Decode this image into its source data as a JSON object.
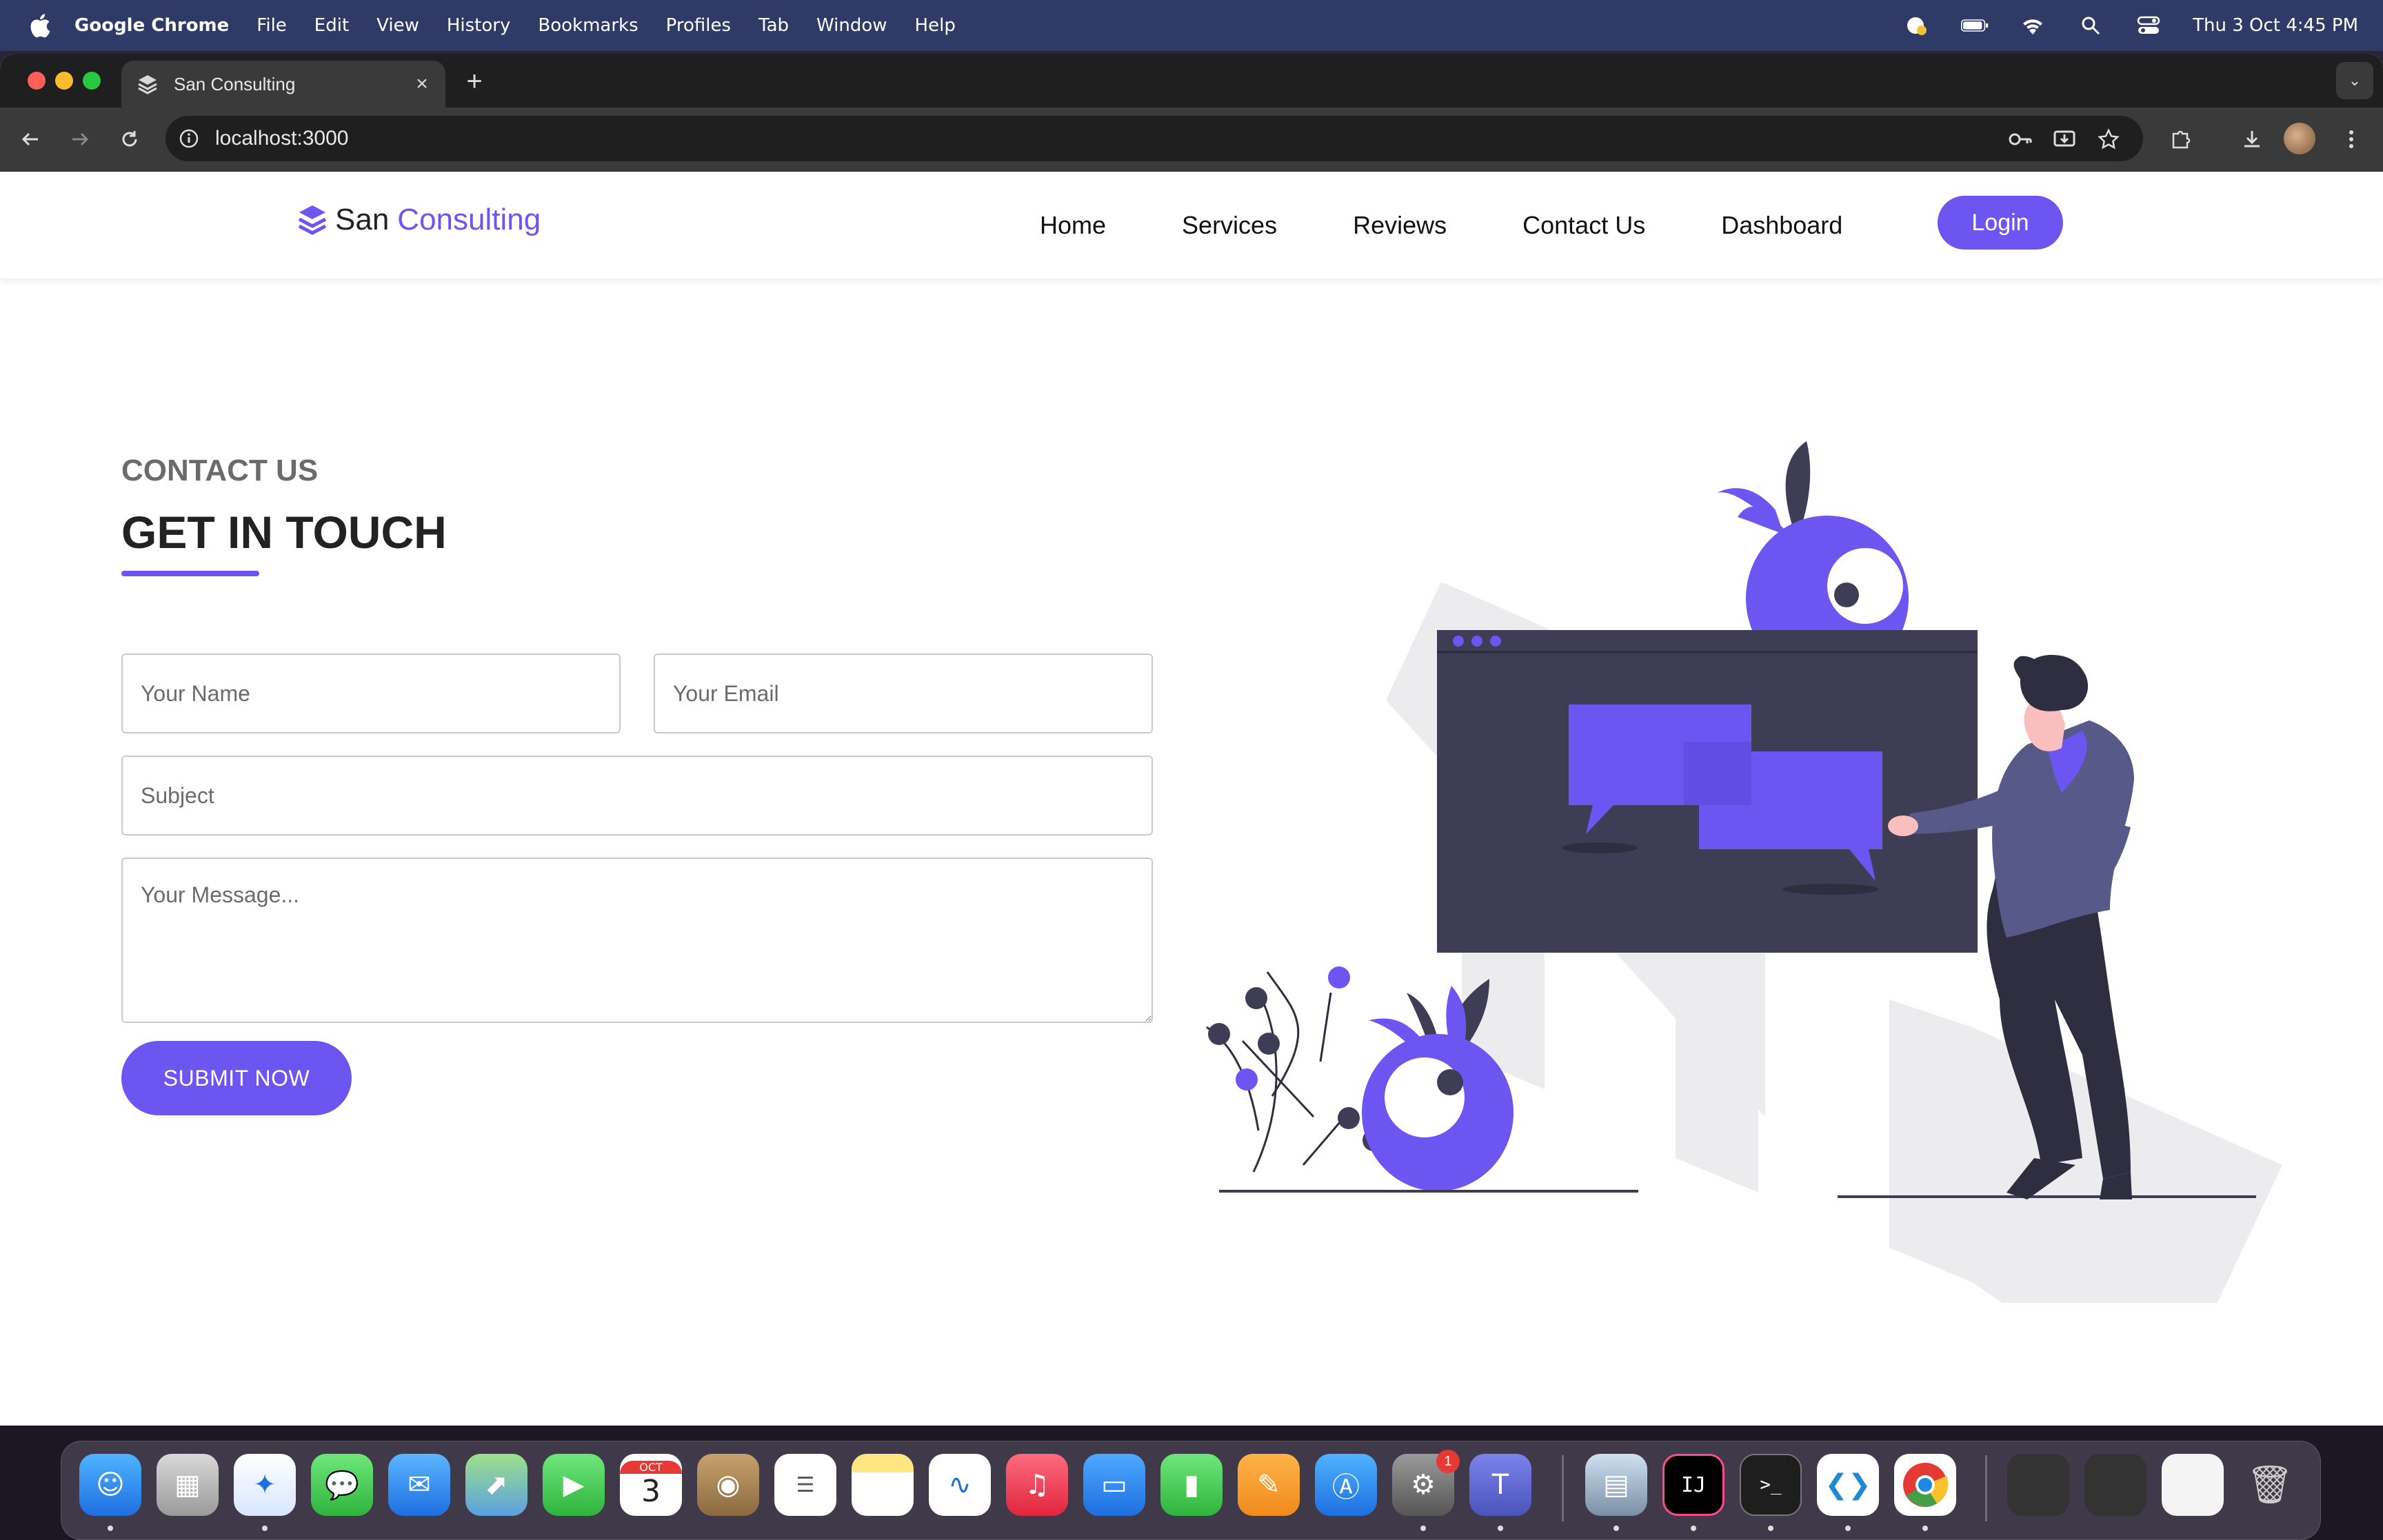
{
  "menubar": {
    "app_name": "Google Chrome",
    "items": [
      "File",
      "Edit",
      "View",
      "History",
      "Bookmarks",
      "Profiles",
      "Tab",
      "Window",
      "Help"
    ],
    "clock": "Thu 3 Oct  4:45 PM"
  },
  "browser": {
    "tab_title": "San Consulting",
    "url": "localhost:3000"
  },
  "site": {
    "brand_first": "San",
    "brand_second": "Consulting",
    "nav": [
      "Home",
      "Services",
      "Reviews",
      "Contact Us",
      "Dashboard"
    ],
    "login_label": "Login",
    "accent_color": "#6c55f0"
  },
  "contact": {
    "kicker": "CONTACT US",
    "heading": "GET IN TOUCH",
    "name_placeholder": "Your Name",
    "email_placeholder": "Your Email",
    "subject_placeholder": "Subject",
    "message_placeholder": "Your Message...",
    "submit_label": "SUBMIT NOW"
  },
  "dock": {
    "apps": [
      "finder-icon",
      "launchpad-icon",
      "safari-icon",
      "messages-icon",
      "mail-icon",
      "maps-icon",
      "facetime-icon",
      "calendar-icon",
      "contacts-icon",
      "reminders-icon",
      "notes-icon",
      "freeform-icon",
      "music-icon",
      "keynote-icon",
      "numbers-icon",
      "pages-icon",
      "app-store-icon",
      "system-settings-icon",
      "teams-icon",
      "preview-icon",
      "intellij-icon",
      "terminal-icon",
      "vscode-icon",
      "chrome-icon",
      "trash-icon"
    ],
    "calendar_month": "OCT",
    "calendar_day": "3",
    "settings_badge": "1"
  }
}
